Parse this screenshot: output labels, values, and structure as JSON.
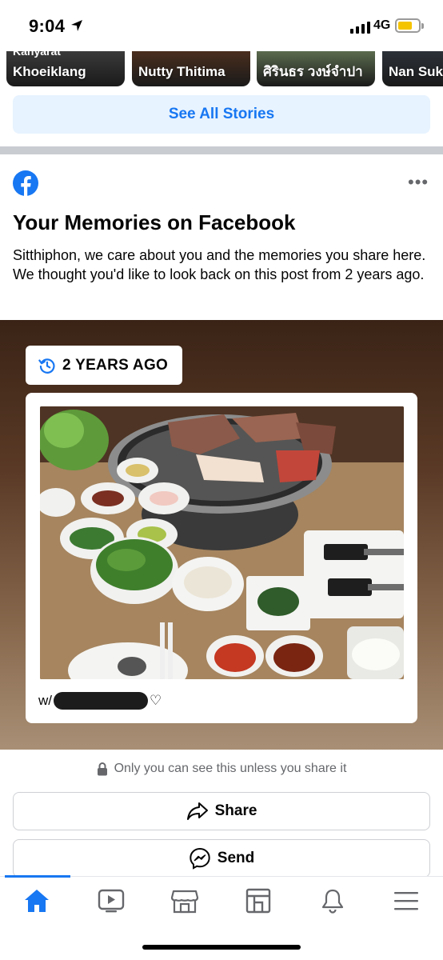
{
  "status_bar": {
    "time": "9:04",
    "network": "4G",
    "battery_level": 0.7
  },
  "stories": [
    {
      "name_top": "Kanyarat",
      "name": "Khoeiklang",
      "bg": "#3a3a3a"
    },
    {
      "name": "Nutty Thitima",
      "bg": "#4a2e1e"
    },
    {
      "name": "ศิรินธร วงษ์จำปา",
      "bg": "#5b6b4e"
    },
    {
      "name": "Nan Suk",
      "bg": "#2c3138"
    }
  ],
  "see_all_stories": "See All Stories",
  "memories": {
    "title": "Your Memories on Facebook",
    "description": "Sitthiphon, we care about you and the memories you share here. We thought you'd like to look back on this post from 2 years ago.",
    "years_ago": "2 YEARS AGO",
    "caption_prefix": "w/",
    "caption_suffix": "♡",
    "privacy_note": "Only you can see this unless you share it",
    "share_label": "Share",
    "send_label": "Send"
  },
  "tabs": [
    {
      "name": "home",
      "active": true
    },
    {
      "name": "watch",
      "active": false
    },
    {
      "name": "marketplace",
      "active": false
    },
    {
      "name": "pages",
      "active": false
    },
    {
      "name": "notifications",
      "active": false
    },
    {
      "name": "menu",
      "active": false
    }
  ],
  "colors": {
    "accent": "#1877f2",
    "light_accent": "#e7f3ff",
    "muted_text": "#65676b"
  }
}
